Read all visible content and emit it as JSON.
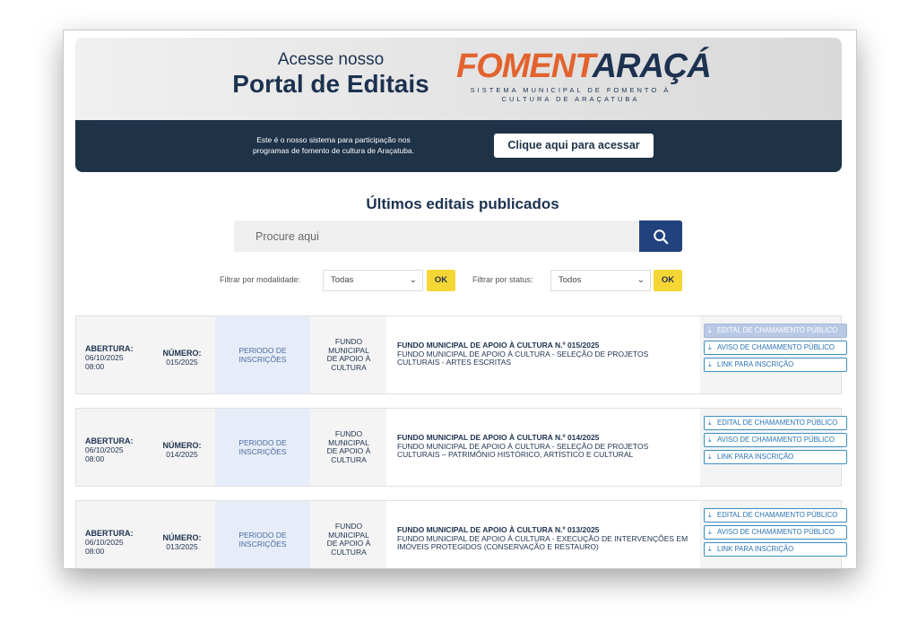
{
  "banner": {
    "portal_line1": "Acesse nosso",
    "portal_line2": "Portal de Editais",
    "logo_part1": "FOMENT",
    "logo_part2": "ARAÇÁ",
    "logo_sub_line1": "SISTEMA MUNICIPAL DE FOMENTO À",
    "logo_sub_line2": "CULTURA DE ARAÇATUBA",
    "desc_line1": "Este é o nosso sistema para participação nos",
    "desc_line2": "programas de fomento de cultura de Araçatuba.",
    "access_button": "Clique aqui para acessar"
  },
  "section_title": "Últimos editais publicados",
  "search": {
    "placeholder": "Procure aqui"
  },
  "filters": {
    "modalidade_label": "Filtrar por modalidade:",
    "modalidade_value": "Todas",
    "status_label": "Filtrar por status:",
    "status_value": "Todos",
    "ok_label": "OK"
  },
  "editais": [
    {
      "abertura_label": "ABERTURA:",
      "abertura_date": "06/10/2025",
      "abertura_time": "08:00",
      "numero_label": "NÚMERO:",
      "numero": "015/2025",
      "period_line1": "PERIODO DE",
      "period_line2": "INSCRIÇÕES",
      "fund_line1": "FUNDO",
      "fund_line2": "MUNICIPAL",
      "fund_line3": "DE APOIO À",
      "fund_line4": "CULTURA",
      "title": "FUNDO MUNICIPAL DE APOIO À CULTURA N.º 015/2025",
      "description": "FUNDO MUNICIPAL DE APOIO À CULTURA - SELEÇÃO DE PROJETOS CULTURAIS - ARTES ESCRITAS",
      "link1": "EDITAL DE CHAMAMENTO PÚBLICO",
      "link2": "AVISO DE CHAMAMENTO PÚBLICO",
      "link3": "LINK PARA INSCRIÇÃO"
    },
    {
      "abertura_label": "ABERTURA:",
      "abertura_date": "06/10/2025",
      "abertura_time": "08:00",
      "numero_label": "NÚMERO:",
      "numero": "014/2025",
      "period_line1": "PERIODO DE",
      "period_line2": "INSCRIÇÕES",
      "fund_line1": "FUNDO",
      "fund_line2": "MUNICIPAL",
      "fund_line3": "DE APOIO À",
      "fund_line4": "CULTURA",
      "title": "FUNDO MUNICIPAL DE APOIO À CULTURA N.º 014/2025",
      "description": "FUNDO MUNICIPAL DE APOIO À CULTURA - SELEÇÃO DE PROJETOS CULTURAIS – PATRIMÔNIO HISTÓRICO, ARTÍSTICO E CULTURAL",
      "link1": "EDITAL DE CHAMAMENTO PÚBLICO",
      "link2": "AVISO DE CHAMAMENTO PÚBLICO",
      "link3": "LINK PARA INSCRIÇÃO"
    },
    {
      "abertura_label": "ABERTURA:",
      "abertura_date": "06/10/2025",
      "abertura_time": "08:00",
      "numero_label": "NÚMERO:",
      "numero": "013/2025",
      "period_line1": "PERIODO DE",
      "period_line2": "INSCRIÇÕES",
      "fund_line1": "FUNDO",
      "fund_line2": "MUNICIPAL",
      "fund_line3": "DE APOIO À",
      "fund_line4": "CULTURA",
      "title": "FUNDO MUNICIPAL DE APOIO À CULTURA N.º 013/2025",
      "description": "FUNDO MUNICIPAL DE APOIO À CULTURA - EXECUÇÃO DE INTERVENÇÕES EM IMÓVEIS PROTEGIDOS (CONSERVAÇÃO E RESTAURO)",
      "link1": "EDITAL DE CHAMAMENTO PÚBLICO",
      "link2": "AVISO DE CHAMAMENTO PÚBLICO",
      "link3": "LINK PARA INSCRIÇÃO"
    }
  ]
}
